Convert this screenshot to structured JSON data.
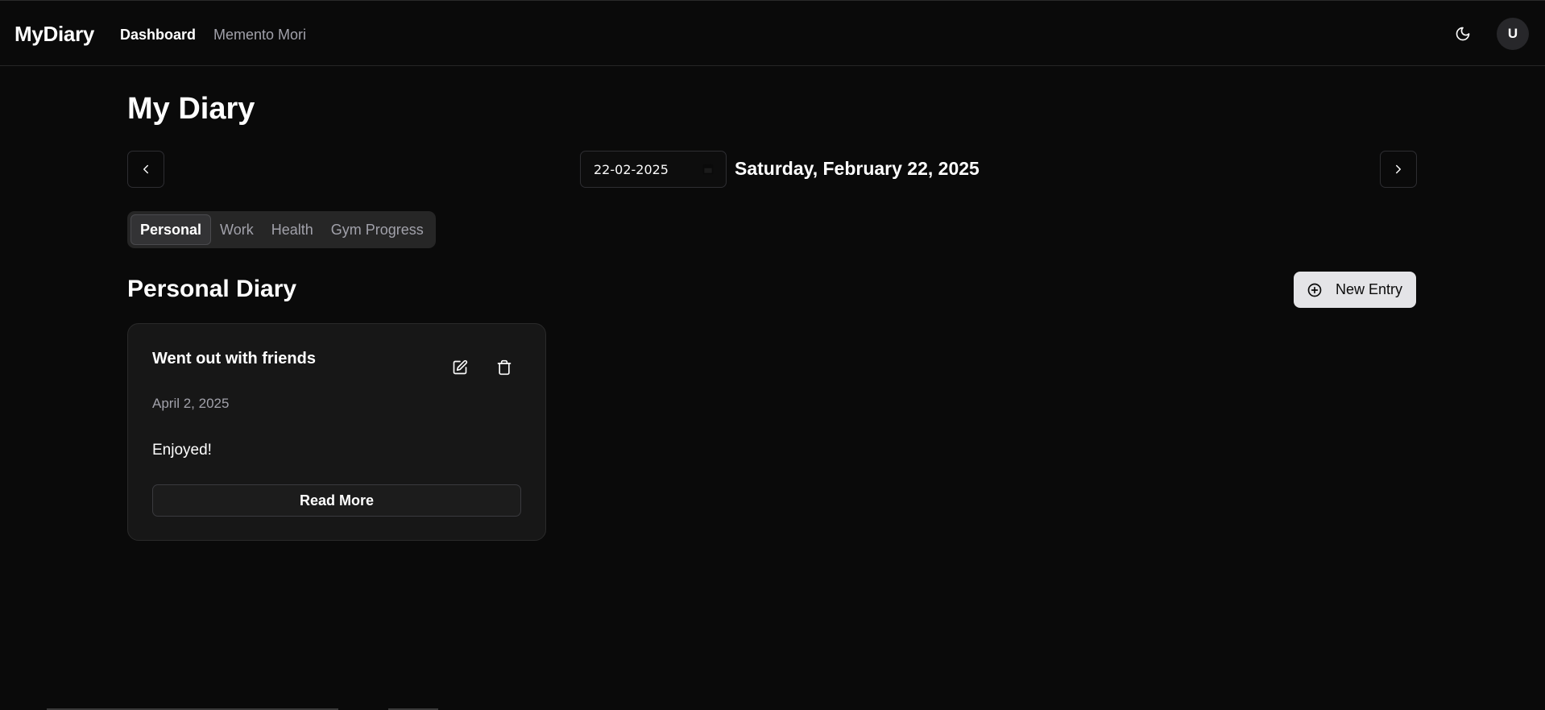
{
  "nav": {
    "brand": "MyDiary",
    "links": [
      {
        "label": "Dashboard",
        "active": true
      },
      {
        "label": "Memento Mori",
        "active": false
      }
    ],
    "theme_icon": "moon-icon",
    "avatar_initial": "U"
  },
  "page": {
    "title": "My Diary"
  },
  "date_nav": {
    "prev_icon": "chevron-left-icon",
    "next_icon": "chevron-right-icon",
    "date_input_value": "22-02-2025",
    "calendar_icon": "calendar-icon",
    "current_date_label": "Saturday, February 22, 2025"
  },
  "tabs": [
    {
      "label": "Personal",
      "active": true
    },
    {
      "label": "Work",
      "active": false
    },
    {
      "label": "Health",
      "active": false
    },
    {
      "label": "Gym Progress",
      "active": false
    }
  ],
  "section": {
    "title": "Personal Diary",
    "new_entry_label": "New Entry",
    "new_entry_icon": "plus-circle-icon"
  },
  "entries": [
    {
      "title": "Went out with friends",
      "date": "April 2, 2025",
      "body": "Enjoyed!",
      "read_more_label": "Read More",
      "edit_icon": "edit-icon",
      "delete_icon": "trash-icon"
    }
  ],
  "colors": {
    "background": "#0a0a0a",
    "card": "#171717",
    "muted_text": "#a1a1aa",
    "primary_button": "#e4e4e7"
  }
}
